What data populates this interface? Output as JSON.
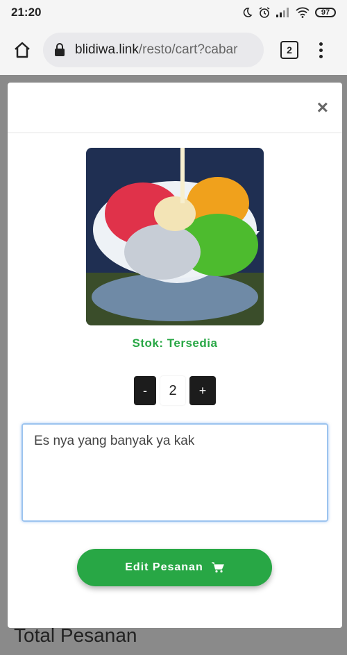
{
  "status_bar": {
    "time": "21:20",
    "battery": "97"
  },
  "browser": {
    "url_domain": "blidiwa.link",
    "url_path": "/resto/cart?cabar",
    "tab_count": "2"
  },
  "modal": {
    "close_label": "×",
    "stock_text": "Stok: Tersedia",
    "quantity": {
      "minus_label": "-",
      "value": "2",
      "plus_label": "+"
    },
    "note_value": "Es nya yang banyak ya kak",
    "submit_label": "Edit Pesanan"
  },
  "background_page": {
    "title": "Total Pesanan"
  },
  "colors": {
    "accent_green": "#28a745",
    "dark_button": "#1c1c1c",
    "focus_blue": "#9cc4ef"
  }
}
